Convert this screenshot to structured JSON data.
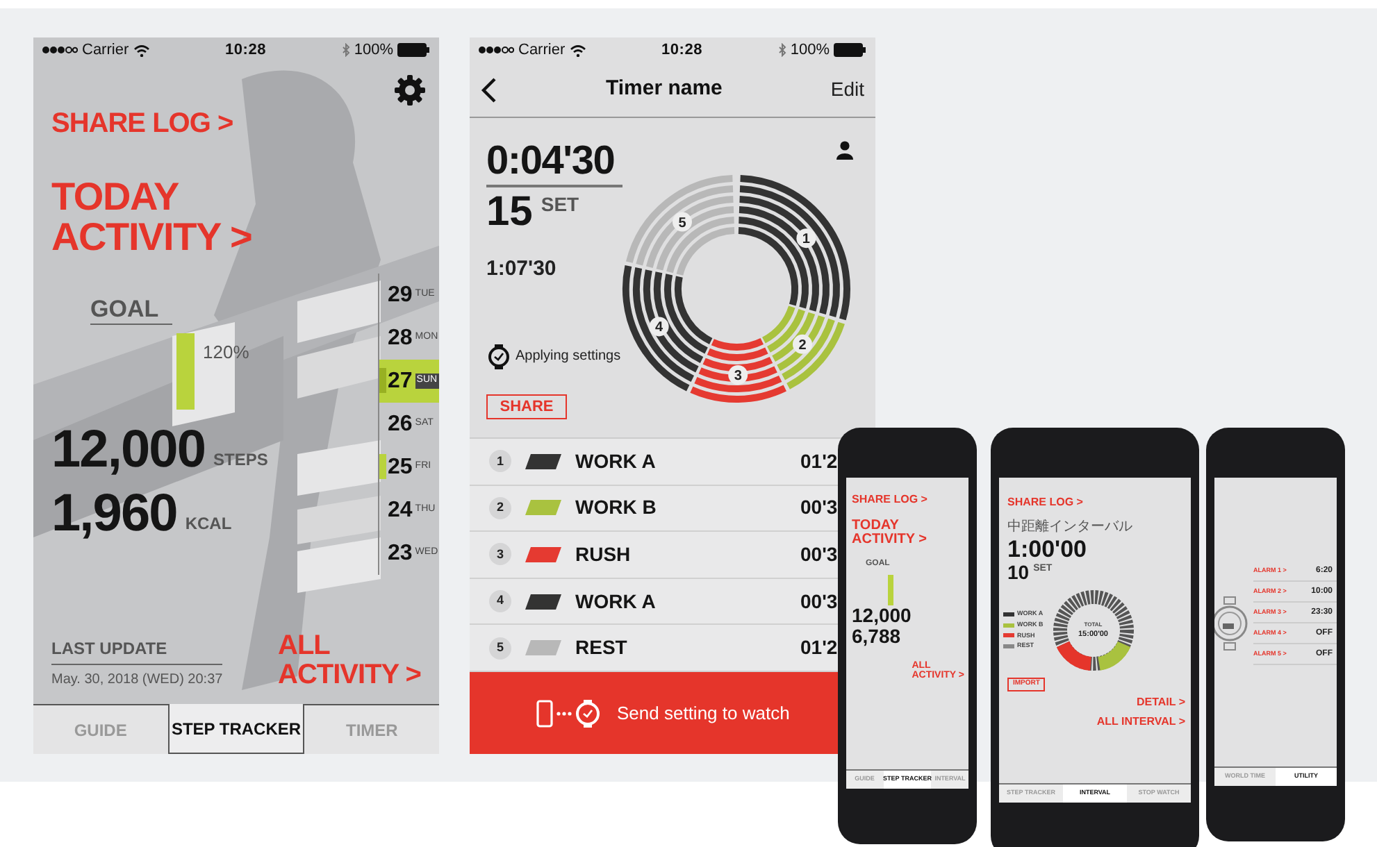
{
  "step_tracker_screen": {
    "status_bar": {
      "carrier": "Carrier",
      "time": "10:28",
      "battery": "100%"
    },
    "share_log": "SHARE LOG >",
    "today_activity": [
      "TODAY",
      "ACTIVITY >"
    ],
    "goal": {
      "label": "GOAL",
      "percent": "120%"
    },
    "days": [
      {
        "day": "29",
        "weekday": "TUE",
        "selected": false,
        "goal_met": false
      },
      {
        "day": "28",
        "weekday": "MON",
        "selected": false,
        "goal_met": false
      },
      {
        "day": "27",
        "weekday": "SUN",
        "selected": true,
        "goal_met": true
      },
      {
        "day": "26",
        "weekday": "SAT",
        "selected": false,
        "goal_met": false
      },
      {
        "day": "25",
        "weekday": "FRI",
        "selected": false,
        "goal_met": true
      },
      {
        "day": "24",
        "weekday": "THU",
        "selected": false,
        "goal_met": false
      },
      {
        "day": "23",
        "weekday": "WED",
        "selected": false,
        "goal_met": false
      }
    ],
    "stats": [
      {
        "value": "12,000",
        "unit": "STEPS"
      },
      {
        "value": "1,960",
        "unit": "KCAL"
      }
    ],
    "last_update": {
      "label": "LAST UPDATE",
      "date": "May. 30, 2018 (WED) 20:37"
    },
    "all_activity": [
      "ALL",
      "ACTIVITY >"
    ],
    "tabs": [
      {
        "label": "GUIDE",
        "selected": false
      },
      {
        "label": "STEP TRACKER",
        "selected": true
      },
      {
        "label": "TIMER",
        "selected": false
      }
    ]
  },
  "timer_screen": {
    "status_bar": {
      "carrier": "Carrier",
      "time": "10:28",
      "battery": "100%"
    },
    "title": "Timer name",
    "edit": "Edit",
    "interval_time": "0:04'30",
    "sets": "15",
    "sets_unit": "SET",
    "total_time": "1:07'30",
    "status": "Applying settings",
    "share": "SHARE",
    "intervals": [
      {
        "number": "1",
        "ring_label": "1",
        "name": "WORK A",
        "duration": "01'2",
        "color": "#333333"
      },
      {
        "number": "2",
        "ring_label": "2",
        "name": "WORK B",
        "duration": "00'3",
        "color": "#a9c23f"
      },
      {
        "number": "3",
        "ring_label": "3",
        "name": "RUSH",
        "duration": "00'3",
        "color": "#e53a31"
      },
      {
        "number": "4",
        "ring_label": "4",
        "name": "WORK A",
        "duration": "00'3",
        "color": "#333333"
      },
      {
        "number": "5",
        "ring_label": "5",
        "name": "REST",
        "duration": "01'2",
        "color": "#b8b8b8"
      }
    ],
    "send_button": "Send setting to watch"
  },
  "phone_mockups": [
    {
      "kind": "steps",
      "share_log": "SHARE LOG >",
      "heading": [
        "TODAY",
        "ACTIVITY >"
      ],
      "goal": "GOAL",
      "stats": [
        "12,000",
        "6,788"
      ],
      "link": [
        "ALL",
        "ACTIVITY >"
      ],
      "tabs": [
        {
          "label": "GUIDE",
          "selected": false
        },
        {
          "label": "STEP TRACKER",
          "selected": true
        },
        {
          "label": "INTERVAL",
          "selected": false
        }
      ]
    },
    {
      "kind": "interval",
      "share_log": "SHARE LOG >",
      "name": "中距離インターバル",
      "time": "1:00'00",
      "sets": "10",
      "sets_unit": "SET",
      "legend": [
        {
          "label": "WORK A",
          "color": "#333333"
        },
        {
          "label": "WORK B",
          "color": "#a9c23f"
        },
        {
          "label": "RUSH",
          "color": "#e53a31"
        },
        {
          "label": "REST",
          "color": "#888888"
        }
      ],
      "total_label": "TOTAL",
      "total": "15:00'00",
      "import": "IMPORT",
      "links": [
        "DETAIL >",
        "ALL INTERVAL >"
      ],
      "tabs": [
        {
          "label": "STEP TRACKER",
          "selected": false
        },
        {
          "label": "INTERVAL",
          "selected": true
        },
        {
          "label": "STOP WATCH",
          "selected": false
        }
      ]
    },
    {
      "kind": "alarms",
      "alarms": [
        {
          "label": "ALARM 1 >",
          "value": "6:20"
        },
        {
          "label": "ALARM 2 >",
          "value": "10:00"
        },
        {
          "label": "ALARM 3 >",
          "value": "23:30"
        },
        {
          "label": "ALARM 4 >",
          "value": "OFF"
        },
        {
          "label": "ALARM 5 >",
          "value": "OFF"
        }
      ],
      "tabs": [
        {
          "label": "WORLD TIME",
          "selected": false
        },
        {
          "label": "UTILITY",
          "selected": true
        }
      ]
    }
  ]
}
